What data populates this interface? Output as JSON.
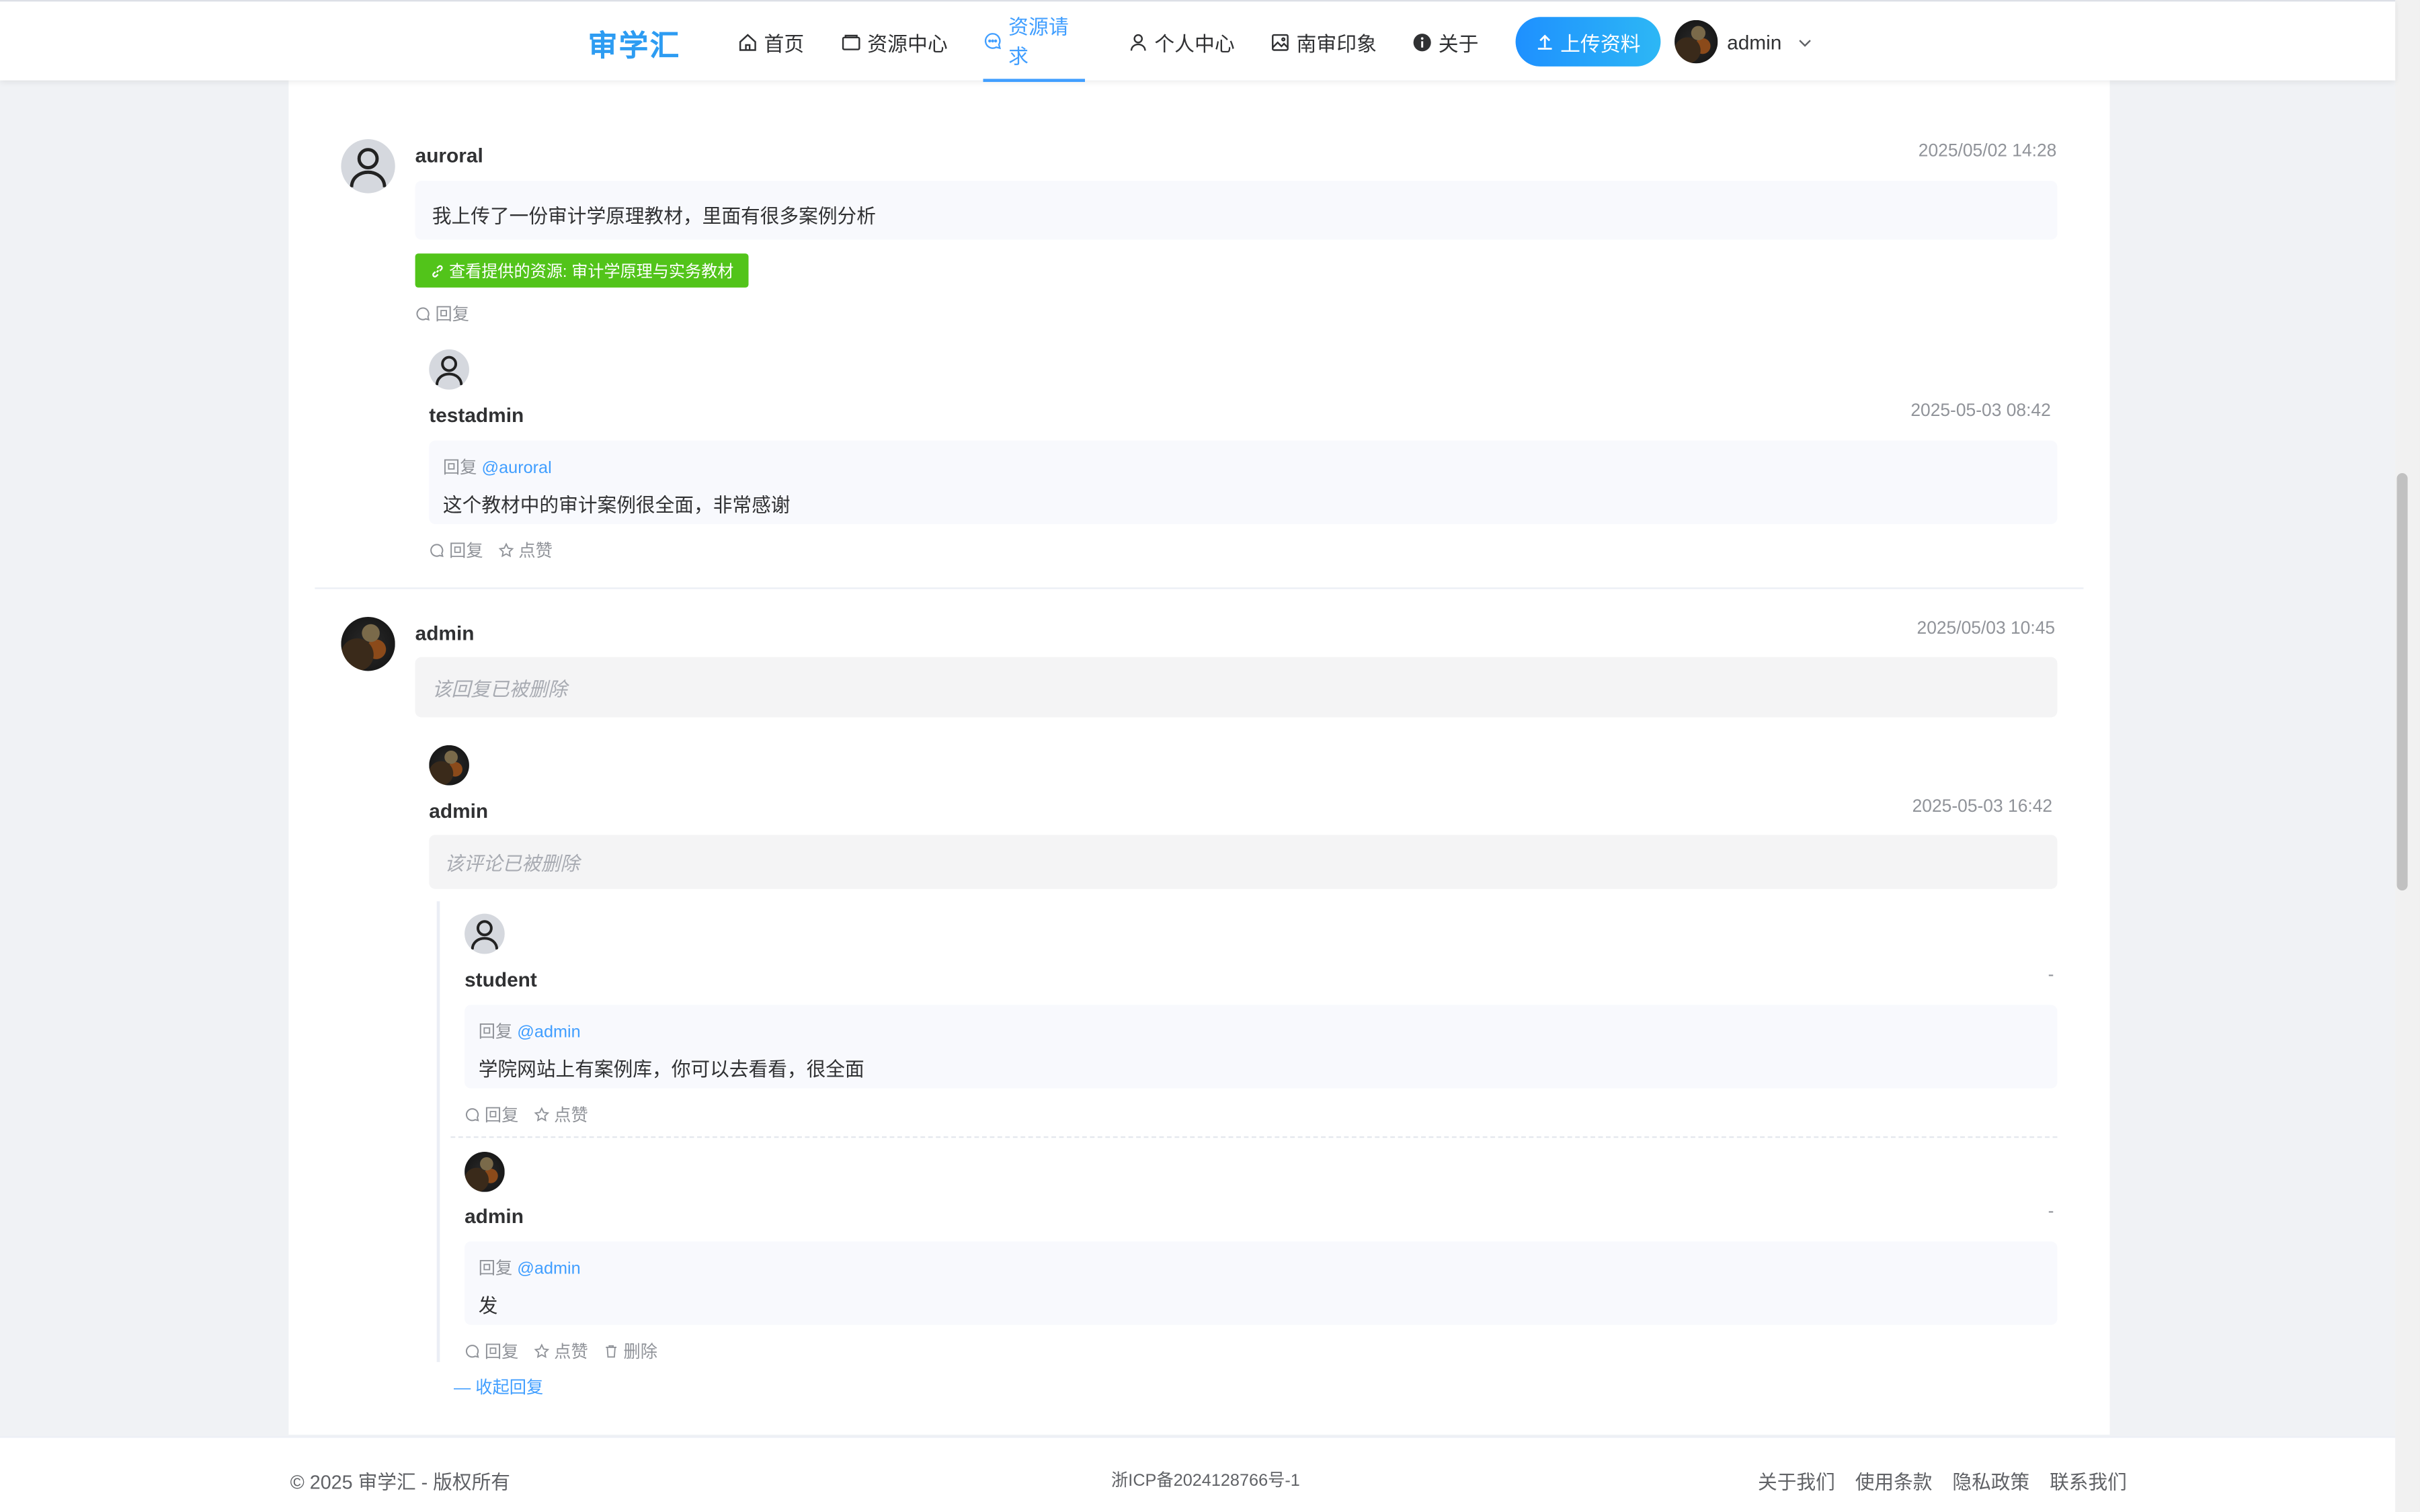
{
  "header": {
    "logo": "审学汇",
    "nav": [
      {
        "label": "首页",
        "icon": "home-icon"
      },
      {
        "label": "资源中心",
        "icon": "box-icon"
      },
      {
        "label": "资源请求",
        "icon": "chat-icon"
      },
      {
        "label": "个人中心",
        "icon": "user-icon"
      },
      {
        "label": "南审印象",
        "icon": "image-icon"
      },
      {
        "label": "关于",
        "icon": "info-icon"
      }
    ],
    "active_nav": "资源请求",
    "upload_label": "上传资料",
    "username": "admin"
  },
  "comments": [
    {
      "user": "auroral",
      "time": "2025/05/02 14:28",
      "content": "我上传了一份审计学原理教材，里面有很多案例分析",
      "resource_link": "查看提供的资源: 审计学原理与实务教材",
      "reply_label": "回复",
      "replies": [
        {
          "user": "testadmin",
          "time": "2025-05-03 08:42",
          "reply_prefix": "回复",
          "reply_to": "@auroral",
          "content": "这个教材中的审计案例很全面，非常感谢",
          "reply_label": "回复",
          "like_label": "点赞"
        }
      ]
    },
    {
      "user": "admin",
      "time": "2025/05/03 10:45",
      "deleted_text": "该回复已被删除",
      "replies": [
        {
          "user": "admin",
          "time": "2025-05-03 16:42",
          "deleted_text": "该评论已被删除",
          "sub_replies": [
            {
              "user": "student",
              "time": "-",
              "reply_prefix": "回复",
              "reply_to": "@admin",
              "content": "学院网站上有案例库，你可以去看看，很全面",
              "reply_label": "回复",
              "like_label": "点赞"
            },
            {
              "user": "admin",
              "time": "-",
              "reply_prefix": "回复",
              "reply_to": "@admin",
              "content": "发",
              "reply_label": "回复",
              "like_label": "点赞",
              "delete_label": "删除"
            }
          ],
          "collapse_label": "收起回复"
        }
      ]
    }
  ],
  "footer": {
    "copyright": "© 2025 审学汇 - 版权所有",
    "icp": "浙ICP备2024128766号-1",
    "links": [
      "关于我们",
      "使用条款",
      "隐私政策",
      "联系我们"
    ]
  },
  "colors": {
    "accent": "#409eff",
    "logo": "#2d9cf2",
    "resource_tag": "#52c41a",
    "background": "#f0f2f5"
  }
}
